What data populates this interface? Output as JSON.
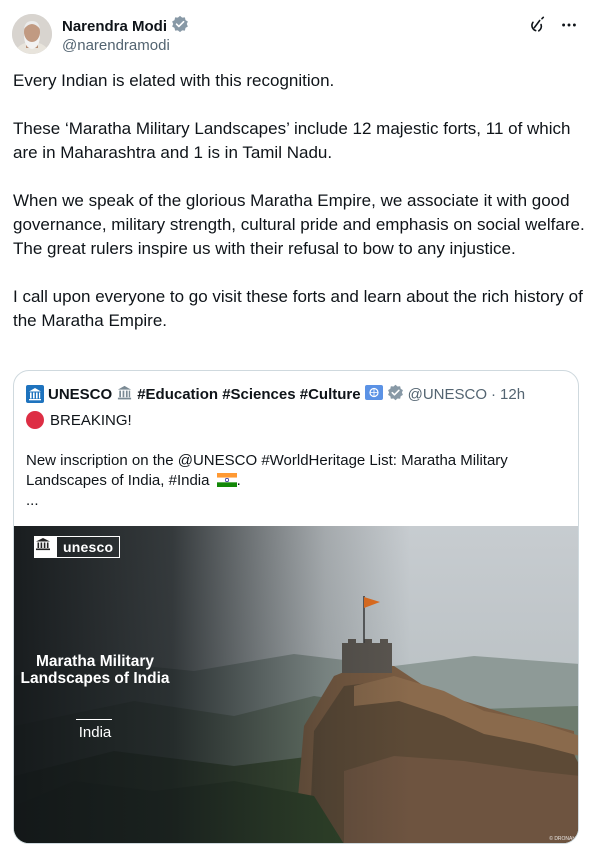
{
  "author": {
    "name": "Narendra Modi",
    "handle": "@narendramodi"
  },
  "tweet": {
    "paragraphs": [
      "Every Indian is elated with this recognition.",
      "These ‘Maratha Military Landscapes’ include 12 majestic forts, 11 of which are in Maharashtra and 1 is in Tamil Nadu.",
      "When we speak of the glorious Maratha Empire, we associate it with good governance, military strength, cultural pride and emphasis on social welfare. The great rulers inspire us with their refusal to bow to any injustice.",
      "I call upon everyone to go visit these forts and learn about the rich history of the Maratha Empire."
    ]
  },
  "actions": {
    "grok_icon": "grok-icon",
    "more_icon": "more-icon"
  },
  "quote": {
    "name": "UNESCO",
    "tags": "#Education #Sciences #Culture",
    "handle": "@UNESCO",
    "separator": "·",
    "time": "12h",
    "breaking": "BREAKING!",
    "text": "New inscription on the @UNESCO #WorldHeritage List: Maratha Military Landscapes of India, #India",
    "text_end": ".",
    "ellipsis": "...",
    "media": {
      "brand": "unesco",
      "title": "Maratha Military Landscapes of India",
      "country": "India",
      "credit": "© DRONAH"
    }
  },
  "colors": {
    "verified": "#1d9bf0",
    "text": "#0f1419",
    "secondary": "#536471",
    "border": "#cfd9de",
    "breaking_dot": "#dd2e44"
  }
}
